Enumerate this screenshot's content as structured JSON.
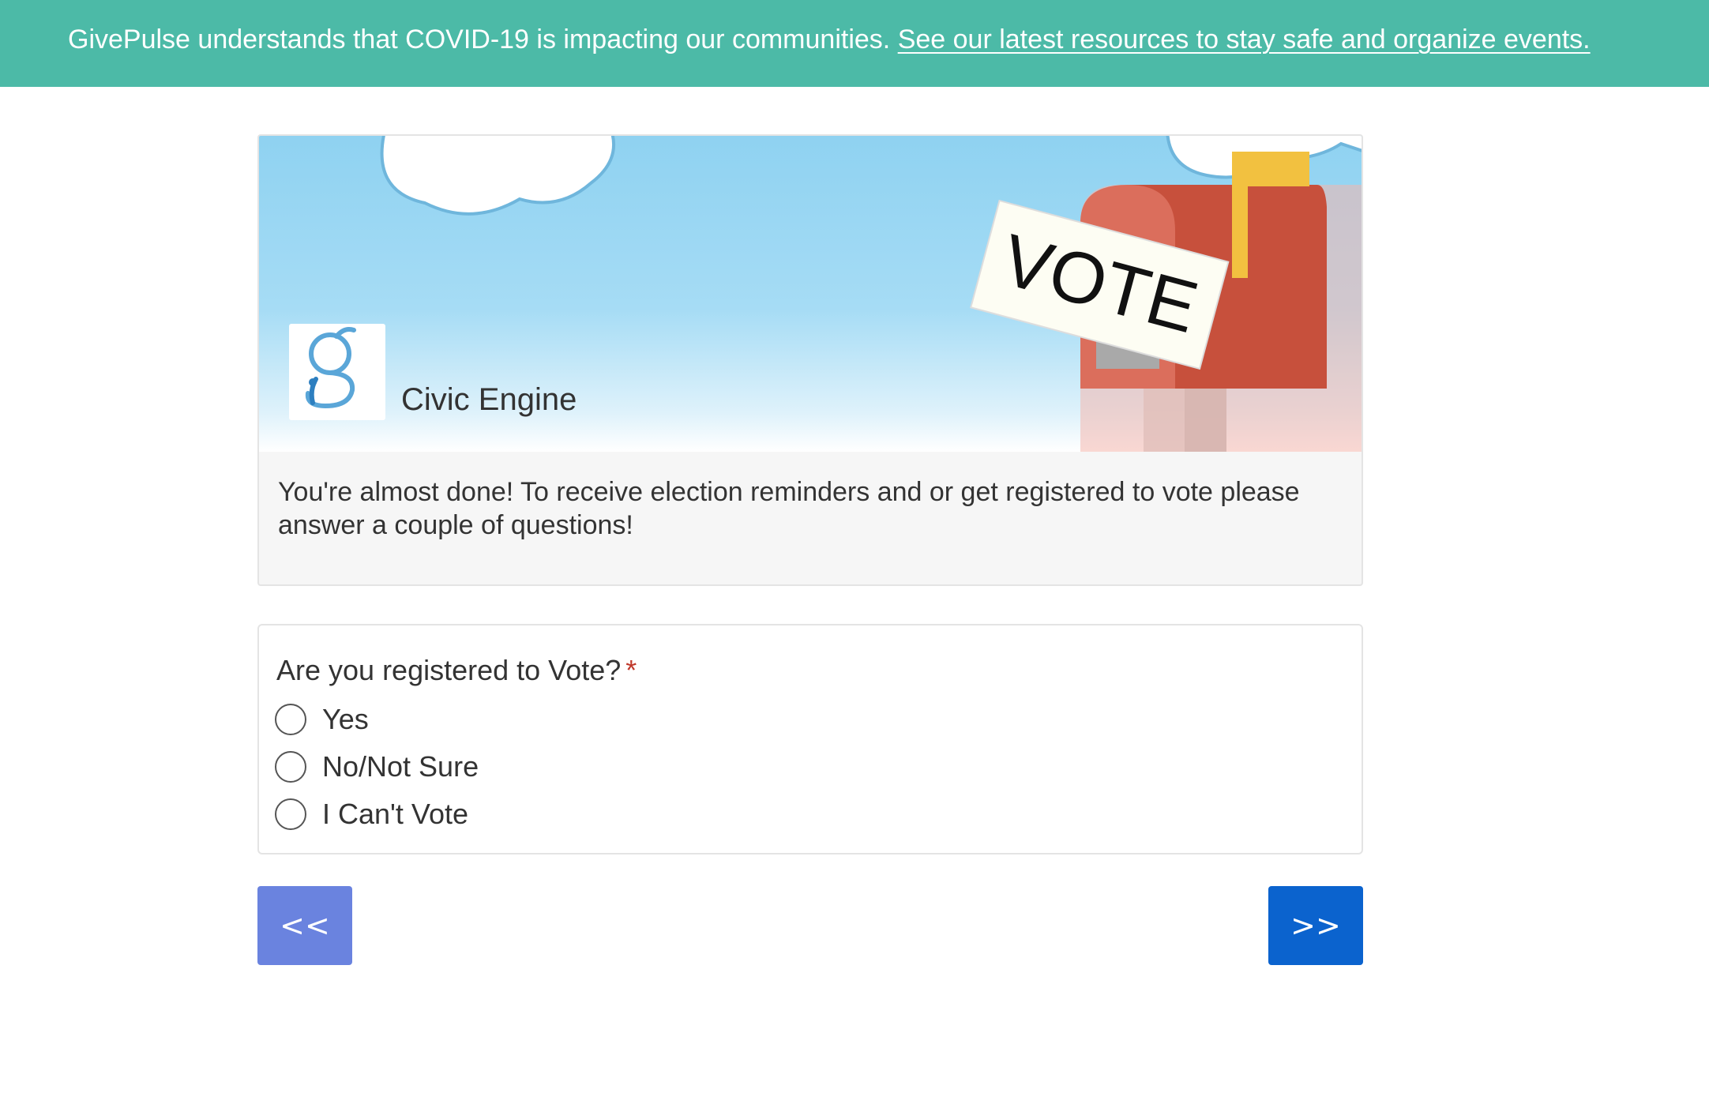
{
  "banner": {
    "text": "GivePulse understands that COVID-19 is impacting our communities.",
    "link": "See our latest resources to stay safe and organize events.",
    "color": "#4cbaa7"
  },
  "header": {
    "hero_sign_text": "VOTE",
    "logo_icon": "givepulse-g-logo",
    "org_name": "Civic Engine",
    "intro": "You're almost done! To receive election reminders and or get registered to vote please answer a couple of questions!"
  },
  "question": {
    "label": "Are you registered to Vote?",
    "required_marker": "*",
    "options": [
      "Yes",
      "No/Not Sure",
      "I Can't Vote"
    ]
  },
  "nav": {
    "back_label": "<<",
    "next_label": ">>",
    "back_color": "#6a83df",
    "next_color": "#0b63ce"
  }
}
